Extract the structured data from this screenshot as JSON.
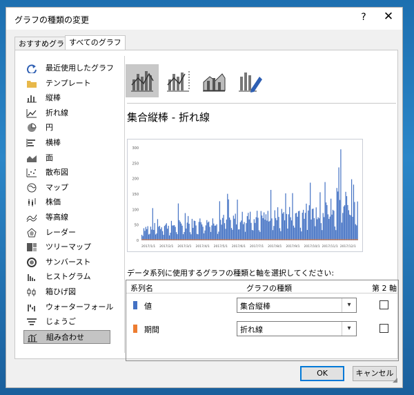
{
  "window": {
    "title": "グラフの種類の変更",
    "help_label": "?",
    "close_label": "✕"
  },
  "tabs": [
    {
      "label": "おすすめグラフ",
      "active": false
    },
    {
      "label": "すべてのグラフ",
      "active": true
    }
  ],
  "sidebar": {
    "items": [
      {
        "label": "最近使用したグラフ",
        "icon": "recent-icon"
      },
      {
        "label": "テンプレート",
        "icon": "folder-icon"
      },
      {
        "label": "縦棒",
        "icon": "column-chart-icon"
      },
      {
        "label": "折れ線",
        "icon": "line-chart-icon"
      },
      {
        "label": "円",
        "icon": "pie-chart-icon"
      },
      {
        "label": "横棒",
        "icon": "bar-chart-icon"
      },
      {
        "label": "面",
        "icon": "area-chart-icon"
      },
      {
        "label": "散布図",
        "icon": "scatter-chart-icon"
      },
      {
        "label": "マップ",
        "icon": "map-chart-icon"
      },
      {
        "label": "株価",
        "icon": "stock-chart-icon"
      },
      {
        "label": "等高線",
        "icon": "surface-chart-icon"
      },
      {
        "label": "レーダー",
        "icon": "radar-chart-icon"
      },
      {
        "label": "ツリーマップ",
        "icon": "treemap-icon"
      },
      {
        "label": "サンバースト",
        "icon": "sunburst-icon"
      },
      {
        "label": "ヒストグラム",
        "icon": "histogram-icon"
      },
      {
        "label": "箱ひげ図",
        "icon": "box-whisker-icon"
      },
      {
        "label": "ウォーターフォール",
        "icon": "waterfall-icon"
      },
      {
        "label": "じょうご",
        "icon": "funnel-icon"
      },
      {
        "label": "組み合わせ",
        "icon": "combo-chart-icon",
        "selected": true
      }
    ]
  },
  "subtypes": [
    {
      "icon": "clustered-column-line-icon",
      "selected": true
    },
    {
      "icon": "clustered-column-line-secondary-icon",
      "selected": false
    },
    {
      "icon": "stacked-area-column-icon",
      "selected": false
    },
    {
      "icon": "custom-combination-icon",
      "selected": false
    }
  ],
  "heading": "集合縦棒 - 折れ線",
  "preview": {
    "y_ticks": [
      "300",
      "250",
      "200",
      "150",
      "100",
      "50",
      "0"
    ],
    "x_ticks": [
      "2017/1/1",
      "2017/2/1",
      "2017/3/1",
      "2017/4/1",
      "2017/5/1",
      "2017/6/1",
      "2017/7/1",
      "2017/8/1",
      "2017/9/1",
      "2017/10/1",
      "2017/11/1",
      "2017/12/1"
    ],
    "bar_color": "#4472c4",
    "line_color": "#ed7d31"
  },
  "series_prompt": "データ系列に使用するグラフの種類と軸を選択してください:",
  "series_table": {
    "headers": {
      "name": "系列名",
      "type": "グラフの種類",
      "secondary": "第 2 軸"
    },
    "rows": [
      {
        "name": "値",
        "color": "#4472c4",
        "type": "集合縦棒",
        "secondary": false
      },
      {
        "name": "期間",
        "color": "#ed7d31",
        "type": "折れ線",
        "secondary": false
      }
    ]
  },
  "buttons": {
    "ok": "OK",
    "cancel": "キャンセル"
  }
}
